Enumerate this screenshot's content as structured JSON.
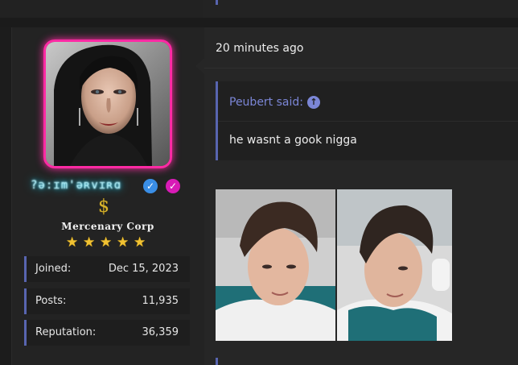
{
  "post": {
    "timestamp": "20 minutes ago",
    "quote": {
      "author_line": "Peubert said:",
      "body": "he wasnt a gook nigga"
    },
    "attachments": [
      {
        "name": "photo-1",
        "description": "selfie photo"
      },
      {
        "name": "photo-2",
        "description": "selfie photo"
      }
    ]
  },
  "user": {
    "username": "?ə:ɪm'əʀvɪʀɑ",
    "group": "Mercenary Corp",
    "dollar": "$",
    "stars": 5,
    "stats": [
      {
        "label": "Joined:",
        "value": "Dec 15, 2023"
      },
      {
        "label": "Posts:",
        "value": "11,935"
      },
      {
        "label": "Reputation:",
        "value": "36,359"
      }
    ],
    "colors": {
      "avatar_border": "#ff2aa4",
      "username_glow": "#19d3ff",
      "accent": "#5865b0",
      "quote_text": "#7b86d6",
      "star": "#f1c232"
    },
    "icons": [
      "verified-icon",
      "checkmark-icon",
      "dollar-icon",
      "star-icon",
      "arrow-up-circle-icon"
    ]
  }
}
